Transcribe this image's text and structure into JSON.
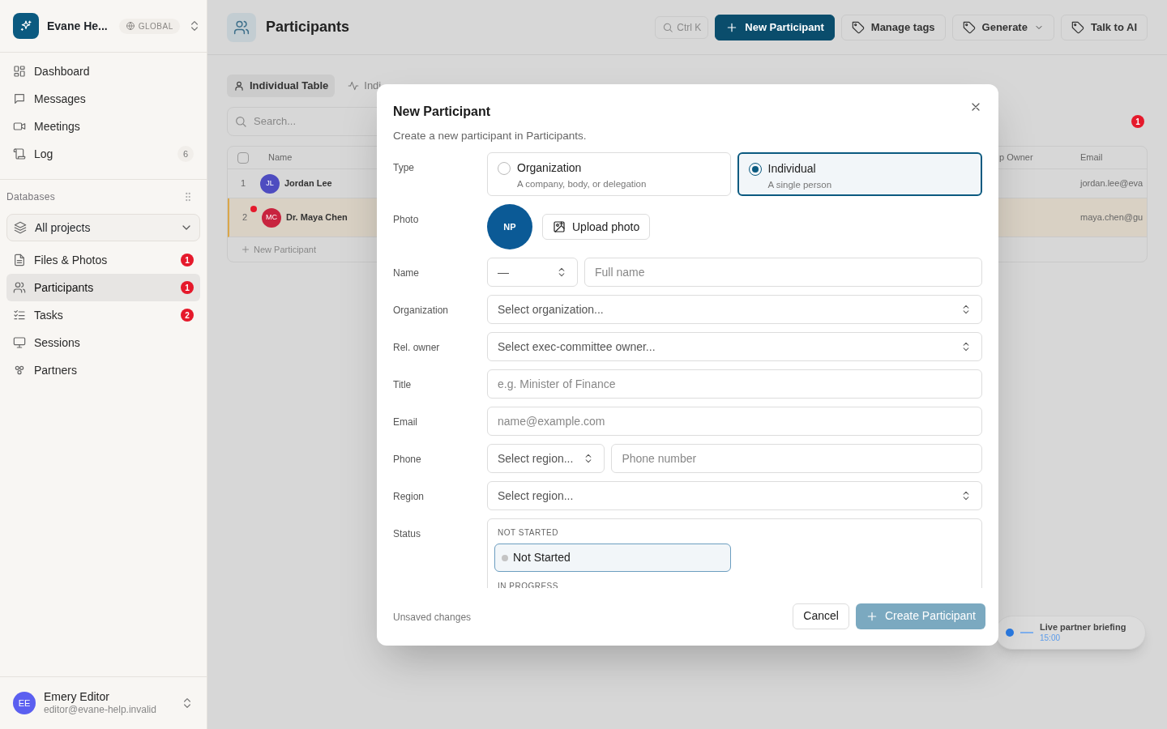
{
  "sidebar": {
    "workspace": {
      "name": "Evane He...",
      "scope": "GLOBAL"
    },
    "nav": [
      {
        "label": "Dashboard"
      },
      {
        "label": "Messages"
      },
      {
        "label": "Meetings"
      },
      {
        "label": "Log",
        "badge": {
          "text": "6",
          "kind": "count"
        }
      }
    ],
    "section_title": "Databases",
    "project_picker": {
      "value": "All projects"
    },
    "databases": [
      {
        "label": "Files & Photos",
        "selected": false,
        "badge": {
          "text": "1",
          "kind": "alert"
        }
      },
      {
        "label": "Participants",
        "selected": true,
        "badge": {
          "text": "1",
          "kind": "alert"
        }
      },
      {
        "label": "Tasks",
        "selected": false,
        "badge": {
          "text": "2",
          "kind": "alert"
        }
      },
      {
        "label": "Sessions",
        "selected": false
      },
      {
        "label": "Partners",
        "selected": false
      }
    ],
    "user": {
      "initials": "EE",
      "name": "Emery Editor",
      "email": "editor@evane-help.invalid"
    }
  },
  "page": {
    "title": "Participants",
    "search_shortcut": "Ctrl K",
    "buttons": [
      {
        "label": "New Participant",
        "kind": "primary"
      },
      {
        "label": "Manage tags",
        "kind": "tag"
      },
      {
        "label": "Generate",
        "kind": "menu"
      },
      {
        "label": "Talk to AI",
        "kind": "tag"
      }
    ],
    "tabs": [
      {
        "label": "Individual Table",
        "selected": true
      },
      {
        "label": "Indi",
        "selected": false
      }
    ],
    "search": {
      "placeholder": "Search..."
    },
    "notification_count": "1",
    "table": {
      "select_all": {
        "checked": false
      },
      "columns": [
        "Name",
        "p Owner",
        "Email"
      ],
      "rows": [
        {
          "index": "1",
          "initials": "JL",
          "color": "#4e4cc0",
          "name": "Jordan Lee",
          "email": "jordan.lee@eva",
          "selected": false,
          "unread": false
        },
        {
          "index": "2",
          "initials": "MC",
          "color": "#c8243f",
          "name": "Dr. Maya Chen",
          "email": "maya.chen@gu",
          "selected": true,
          "unread": true
        }
      ],
      "add_row": "New Participant"
    },
    "toast": {
      "title": "Live partner briefing",
      "time": "15:00"
    }
  },
  "dialog": {
    "title": "New Participant",
    "subtitle": "Create a new participant in Participants.",
    "rows": [
      {
        "label": "Type",
        "kind": "choice",
        "options": [
          {
            "title": "Organization",
            "description": "A company, body, or delegation",
            "selected": false
          },
          {
            "title": "Individual",
            "description": "A single person",
            "selected": true
          }
        ]
      },
      {
        "label": "Photo",
        "kind": "photo",
        "initials": "NP",
        "button": "Upload photo"
      },
      {
        "label": "Name",
        "kind": "fields",
        "controls": [
          {
            "kind": "select",
            "value": "—"
          },
          {
            "kind": "input",
            "placeholder": "Full name"
          }
        ]
      },
      {
        "label": "Organization",
        "kind": "fields",
        "controls": [
          {
            "kind": "select",
            "value": "Select organization..."
          }
        ]
      },
      {
        "label": "Rel. owner",
        "kind": "fields",
        "controls": [
          {
            "kind": "select",
            "value": "Select exec-committee owner..."
          }
        ]
      },
      {
        "label": "Title",
        "kind": "fields",
        "controls": [
          {
            "kind": "input",
            "placeholder": "e.g. Minister of Finance"
          }
        ]
      },
      {
        "label": "Email",
        "kind": "fields",
        "controls": [
          {
            "kind": "input",
            "placeholder": "name@example.com"
          }
        ]
      },
      {
        "label": "Phone",
        "kind": "fields",
        "controls": [
          {
            "kind": "select",
            "value": "Select region..."
          },
          {
            "kind": "input",
            "placeholder": "Phone number"
          }
        ]
      },
      {
        "label": "Region",
        "kind": "fields",
        "controls": [
          {
            "kind": "select",
            "value": "Select region..."
          }
        ]
      },
      {
        "label": "Status",
        "kind": "list",
        "groups": [
          {
            "title": "NOT STARTED",
            "options": [
              {
                "label": "Not Started",
                "selected": true,
                "color": "#c4c4c4"
              }
            ]
          },
          {
            "title": "IN PROGRESS"
          }
        ]
      }
    ],
    "footer_note": "Unsaved changes",
    "cancel": "Cancel",
    "submit": {
      "label": "Create Participant",
      "disabled": true
    }
  }
}
